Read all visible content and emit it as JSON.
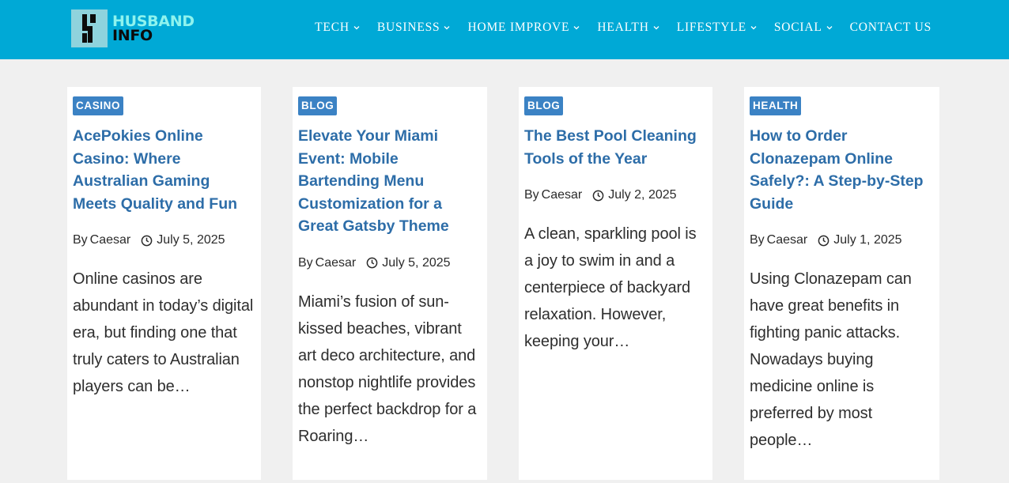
{
  "logo": {
    "line1": "HUSBAND",
    "line2": "INFO"
  },
  "nav": [
    {
      "label": "TECH",
      "has_dropdown": true
    },
    {
      "label": "BUSINESS",
      "has_dropdown": true
    },
    {
      "label": "HOME IMPROVE",
      "has_dropdown": true
    },
    {
      "label": "HEALTH",
      "has_dropdown": true
    },
    {
      "label": "LIFESTYLE",
      "has_dropdown": true
    },
    {
      "label": "SOCIAL",
      "has_dropdown": true
    },
    {
      "label": "CONTACT US",
      "has_dropdown": false
    }
  ],
  "colors": {
    "header": "#00a9d6",
    "badge": "#3b82c4",
    "title": "#2d6da8",
    "page_bg": "#f0f0f0"
  },
  "posts": [
    {
      "category": "CASINO",
      "title": "AcePokies Online Casino: Where Australian Gaming Meets Quality and Fun",
      "by": "By",
      "author": "Caesar",
      "date": "July 5, 2025",
      "excerpt": "Online casinos are abundant in today’s digital era, but finding one that truly caters to Australian players can be…"
    },
    {
      "category": "BLOG",
      "title": "Elevate Your Miami Event: Mobile Bartending Menu Customization for a Great Gatsby Theme",
      "by": "By",
      "author": "Caesar",
      "date": "July 5, 2025",
      "excerpt": "Miami’s fusion of sun-kissed beaches, vibrant art deco architecture, and nonstop nightlife provides the perfect backdrop for a Roaring…"
    },
    {
      "category": "BLOG",
      "title": "The Best Pool Cleaning Tools of the Year",
      "by": "By",
      "author": "Caesar",
      "date": "July 2, 2025",
      "excerpt": "A clean, sparkling pool is a joy to swim in and a centerpiece of backyard relaxation. However, keeping your…"
    },
    {
      "category": "HEALTH",
      "title": "How to Order Clonazepam Online Safely?: A Step-by-Step Guide",
      "by": "By",
      "author": "Caesar",
      "date": "July 1, 2025",
      "excerpt": "Using Clonazepam can have great benefits in fighting panic attacks. Nowadays buying medicine online is preferred by most people…"
    }
  ]
}
